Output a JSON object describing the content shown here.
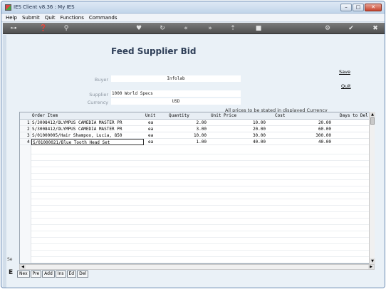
{
  "window": {
    "title": "IES Client v8.36 : My IES"
  },
  "menu": [
    "Help",
    "Submit",
    "Quit",
    "Functions",
    "Commands"
  ],
  "toolbar_icons": [
    "key-icon",
    "info-icon",
    "search-icon",
    "heart-icon",
    "refresh-icon",
    "rewind-icon",
    "fast-forward-icon",
    "upload-icon",
    "stop-icon",
    "settings-icon",
    "check-icon",
    "close-icon"
  ],
  "page": {
    "title": "Feed Supplier Bid"
  },
  "form": {
    "buyer_label": "Buyer",
    "buyer_value": "Infolab",
    "supplier_label": "Supplier",
    "supplier_value": "1000 World Specs",
    "currency_label": "Currency",
    "currency_value": "USD"
  },
  "links": {
    "save": "Save",
    "quit": "Quit"
  },
  "note": "All prices to be stated in displayed Currency",
  "grid": {
    "columns": [
      "Order Item",
      "Unit",
      "Quantity",
      "Unit Price",
      "Cost",
      "Days to Del"
    ],
    "rows": [
      {
        "n": "1",
        "item": "S/3008412/OLYMPUS CAMEDIA MASTER PR",
        "unit": "ea",
        "qty": "2.00",
        "price": "10.00",
        "cost": "20.00"
      },
      {
        "n": "2",
        "item": "S/3008412/OLYMPUS CAMEDIA MASTER PR",
        "unit": "ea",
        "qty": "3.00",
        "price": "20.00",
        "cost": "60.00"
      },
      {
        "n": "3",
        "item": "S/01000005/Hair Shampoo, Lucia, 850",
        "unit": "ea",
        "qty": "10.00",
        "price": "30.00",
        "cost": "300.00"
      },
      {
        "n": "4",
        "item": "S/01000021/Blue Tooth Head Set",
        "unit": "ea",
        "qty": "1.00",
        "price": "40.00",
        "cost": "40.00"
      }
    ]
  },
  "bottom_tabs": [
    "Nex",
    "Pre",
    "Add",
    "Ins",
    "Ed",
    "Del"
  ],
  "side": {
    "mark": "Se",
    "mark2": "E"
  }
}
